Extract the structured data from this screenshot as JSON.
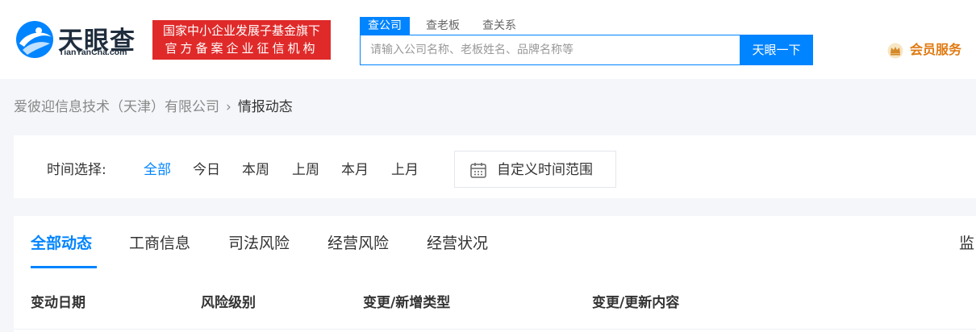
{
  "header": {
    "logo_cn": "天眼查",
    "logo_en": "TianYanCha.com",
    "badge_line1": "国家中小企业发展子基金旗下",
    "badge_line2": "官方备案企业征信机构",
    "search_tabs": [
      "查公司",
      "查老板",
      "查关系"
    ],
    "search_placeholder": "请输入公司名称、老板姓名、品牌名称等",
    "search_button": "天眼一下",
    "vip_label": "会员服务",
    "brand_color": "#0084ff",
    "badge_color": "#e02a2a",
    "vip_color": "#e07a12"
  },
  "breadcrumb": {
    "company": "爱彼迎信息技术（天津）有限公司",
    "current": "情报动态"
  },
  "time_filter": {
    "label": "时间选择:",
    "options": [
      "全部",
      "今日",
      "本周",
      "上周",
      "本月",
      "上月"
    ],
    "selected": "全部",
    "custom_label": "自定义时间范围"
  },
  "tabs": {
    "items": [
      "全部动态",
      "工商信息",
      "司法风险",
      "经营风险",
      "经营状况"
    ],
    "active": "全部动态",
    "right_partial": "监"
  },
  "table": {
    "headers": [
      "变动日期",
      "风险级别",
      "变更/新增类型",
      "变更/更新内容"
    ]
  },
  "icons": {
    "logo": "tianyancha-eye-logo",
    "vip": "crown-icon",
    "calendar": "calendar-icon"
  }
}
